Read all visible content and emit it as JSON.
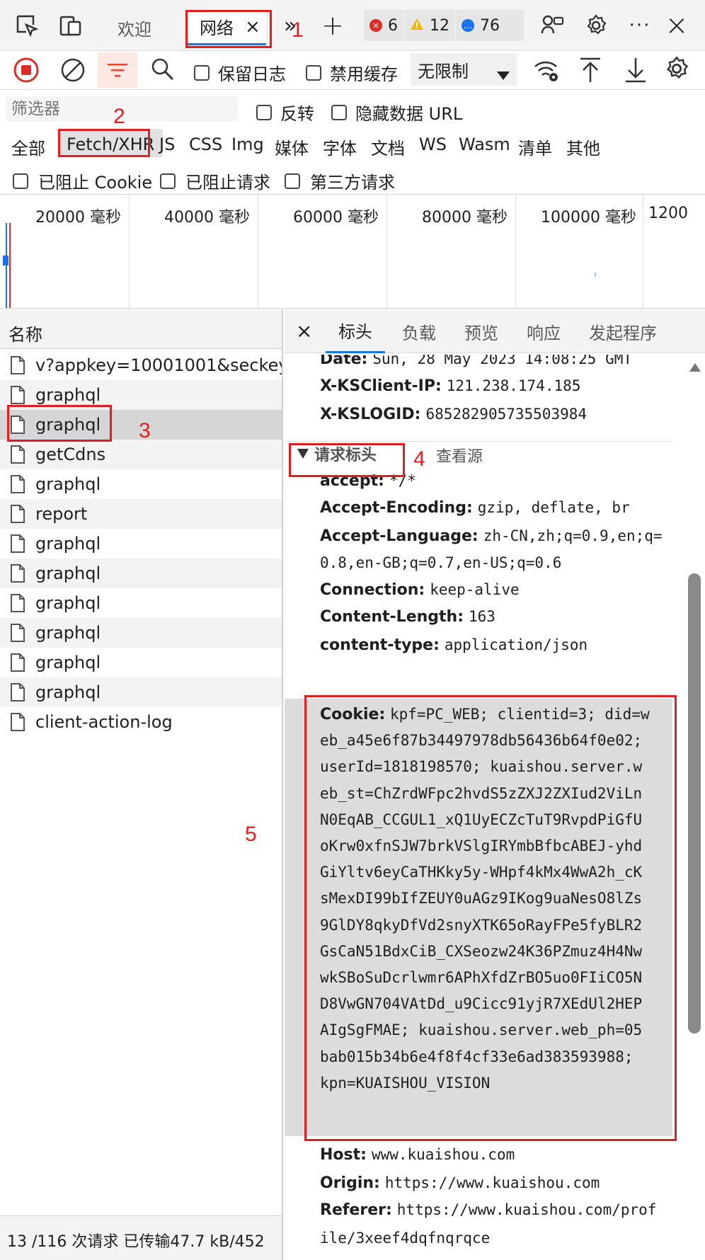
{
  "tabbar": {
    "welcome_tab": "欢迎",
    "network_tab": "网络",
    "close_glyph": "×",
    "more_glyph": "»",
    "add_glyph": "+",
    "errors": "6",
    "warnings": "12",
    "messages": "76",
    "more_menu_glyph": "···",
    "close_devtools_glyph": "×"
  },
  "toolbar": {
    "preserve_log": "保留日志",
    "disable_cache": "禁用缓存",
    "throttle": "无限制"
  },
  "filter": {
    "placeholder": "筛选器",
    "invert": "反转",
    "hide_data_url": "隐藏数据 URL",
    "types": [
      "全部",
      "Fetch/XHR",
      "JS",
      "CSS",
      "Img",
      "媒体",
      "字体",
      "文档",
      "WS",
      "Wasm",
      "清单",
      "其他"
    ],
    "blocked_cookies": "已阻止 Cookie",
    "blocked_requests": "已阻止请求",
    "third_party": "第三方请求"
  },
  "timeline": {
    "ticks": [
      "20000 毫秒",
      "40000 毫秒",
      "60000 毫秒",
      "80000 毫秒",
      "100000 毫秒",
      "1200"
    ]
  },
  "requests": {
    "header": "名称",
    "items": [
      "v?appkey=10001001&seckey...",
      "graphql",
      "graphql",
      "getCdns",
      "graphql",
      "report",
      "graphql",
      "graphql",
      "graphql",
      "graphql",
      "graphql",
      "graphql",
      "client-action-log"
    ],
    "status": "13 /116 次请求   已传输47.7 kB/452"
  },
  "details": {
    "close_glyph": "×",
    "tabs": [
      "标头",
      "负载",
      "预览",
      "响应",
      "发起程序"
    ],
    "response_headers": [
      {
        "key": "Date:",
        "value": "Sun, 28 May 2023 14:08:25 GMT"
      },
      {
        "key": "X-KSClient-IP:",
        "value": "121.238.174.185"
      },
      {
        "key": "X-KSLOGID:",
        "value": "685282905735503984"
      }
    ],
    "request_section_title": "请求标头",
    "view_source": "查看源",
    "request_headers": [
      {
        "key": "accept:",
        "value": "*/*"
      },
      {
        "key": "Accept-Encoding:",
        "value": "gzip, deflate, br"
      },
      {
        "key": "Accept-Language:",
        "value": "zh-CN,zh;q=0.9,en;q="
      },
      {
        "key": "",
        "value": "0.8,en-GB;q=0.7,en-US;q=0.6"
      },
      {
        "key": "Connection:",
        "value": "keep-alive"
      },
      {
        "key": "Content-Length:",
        "value": "163"
      },
      {
        "key": "content-type:",
        "value": "application/json"
      }
    ],
    "cookie_key": "Cookie:",
    "cookie_lines": [
      "kpf=PC_WEB; clientid=3; did=w",
      "eb_a45e6f87b34497978db56436b64f0e02;",
      "userId=1818198570; kuaishou.server.w",
      "eb_st=ChZrdWFpc2hvdS5zZXJ2ZXIud2ViLn",
      "N0EqAB_CCGUL1_xQ1UyECZcTuT9RvpdPiGfU",
      "oKrw0xfnSJW7brkVSlgIRYmbBfbcABEJ-yhd",
      "GiYltv6eyCaTHKky5y-WHpf4kMx4WwA2h_cK",
      "sMexDI99bIfZEUY0uAGz9IKog9uaNesO8lZs",
      "9GlDY8qkyDfVd2snyXTK65oRayFPe5fyBLR2",
      "GsCaN51BdxCiB_CXSeozw24K36PZmuz4H4Nw",
      "wkSBoSuDcrlwmr6APhXfdZrBO5uo0FIiCO5N",
      "D8VwGN704VAtDd_u9Cicc91yjR7XEdUl2HEP",
      "AIgSgFMAE; kuaishou.server.web_ph=05",
      "bab015b34b6e4f8f4cf33e6ad383593988;",
      "kpn=KUAISHOU_VISION"
    ],
    "after_headers": [
      {
        "key": "Host:",
        "value": "www.kuaishou.com"
      },
      {
        "key": "Origin:",
        "value": "https://www.kuaishou.com"
      },
      {
        "key": "Referer:",
        "value": "https://www.kuaishou.com/prof"
      },
      {
        "key": "",
        "value": "ile/3xeef4dqfnqrqce"
      }
    ]
  },
  "annotations": [
    "1",
    "2",
    "3",
    "4",
    "5"
  ],
  "colors": {
    "accent": "#1a73e8",
    "annotation": "#e02020",
    "record": "#d93025",
    "filter": "#e8452c"
  }
}
